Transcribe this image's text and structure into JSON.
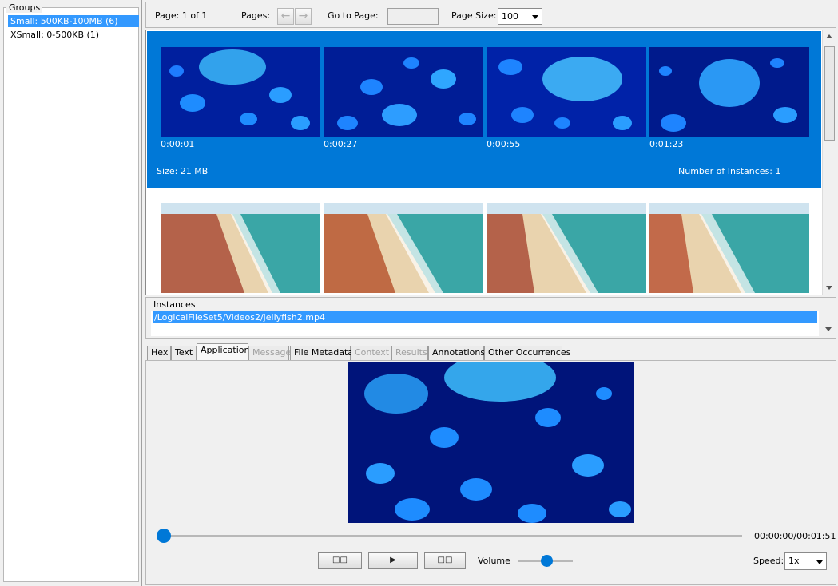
{
  "groups": {
    "title": "Groups",
    "items": [
      {
        "label": "Small: 500KB-100MB (6)",
        "selected": true
      },
      {
        "label": "XSmall: 0-500KB (1)",
        "selected": false
      }
    ]
  },
  "toolbar": {
    "page_label": "Page: 1 of 1",
    "pages_label": "Pages:",
    "prev_icon": "arrow-left-icon",
    "next_icon": "arrow-right-icon",
    "goto_label": "Go to Page:",
    "goto_value": "",
    "page_size_label": "Page Size:",
    "page_size_value": "100"
  },
  "results": [
    {
      "selected": true,
      "thumb_subject": "jellyfish",
      "times": [
        "0:00:01",
        "0:00:27",
        "0:00:55",
        "0:01:23"
      ],
      "size": "Size: 21 MB",
      "instances": "Number of Instances: 1"
    },
    {
      "selected": false,
      "thumb_subject": "coastline",
      "times": [],
      "size": "",
      "instances": ""
    }
  ],
  "instances": {
    "title": "Instances",
    "items": [
      "/LogicalFileSet5/Videos2/jellyfish2.mp4"
    ]
  },
  "tabs": [
    {
      "label": "Hex",
      "enabled": true,
      "active": false
    },
    {
      "label": "Text",
      "enabled": true,
      "active": false
    },
    {
      "label": "Application",
      "enabled": true,
      "active": true
    },
    {
      "label": "Message",
      "enabled": false,
      "active": false
    },
    {
      "label": "File Metadata",
      "enabled": true,
      "active": false
    },
    {
      "label": "Context",
      "enabled": false,
      "active": false
    },
    {
      "label": "Results",
      "enabled": false,
      "active": false
    },
    {
      "label": "Annotations",
      "enabled": true,
      "active": false
    },
    {
      "label": "Other Occurrences",
      "enabled": true,
      "active": false
    }
  ],
  "player": {
    "time": "00:00:00/00:01:51",
    "seek_position": 0.0,
    "volume_label": "Volume",
    "volume_level": 0.5,
    "speed_label": "Speed:",
    "speed_value": "1x",
    "rewind_icon": "skip-back-icon",
    "play_icon": "play-icon",
    "forward_icon": "skip-forward-icon",
    "accent": "#0078d7"
  },
  "colors": {
    "selection": "#3399ff",
    "selected_row": "#0078d7"
  }
}
